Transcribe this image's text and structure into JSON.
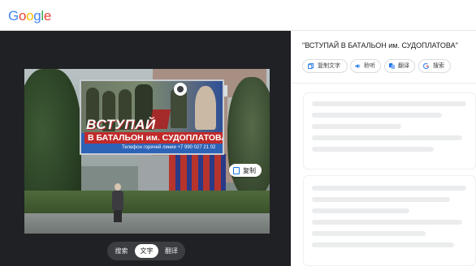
{
  "header": {
    "logo_text": "Google"
  },
  "image_panel": {
    "billboard": {
      "line1": "ВСТУПАЙ",
      "line2": "В БАТАЛЬОН им. СУДОПЛАТОВА",
      "hotline": "Телефон горячей линии +7 990 027 21 02"
    },
    "copy_chip_label": "复制",
    "modes": [
      {
        "label": "搜索",
        "active": false
      },
      {
        "label": "文字",
        "active": true
      },
      {
        "label": "翻译",
        "active": false
      }
    ]
  },
  "results": {
    "detected_text": "\"ВСТУПАЙ В БАТАЛЬОН им. СУДОПЛАТОВА\"",
    "actions": [
      {
        "label": "复制文字",
        "icon": "copy-icon"
      },
      {
        "label": "聆听",
        "icon": "speaker-icon"
      },
      {
        "label": "翻译",
        "icon": "translate-icon"
      },
      {
        "label": "搜索",
        "icon": "google-g-icon"
      }
    ]
  },
  "colors": {
    "accent": "#1a73e8",
    "dark_panel": "#202124",
    "segment_bg": "#3c3d40"
  }
}
